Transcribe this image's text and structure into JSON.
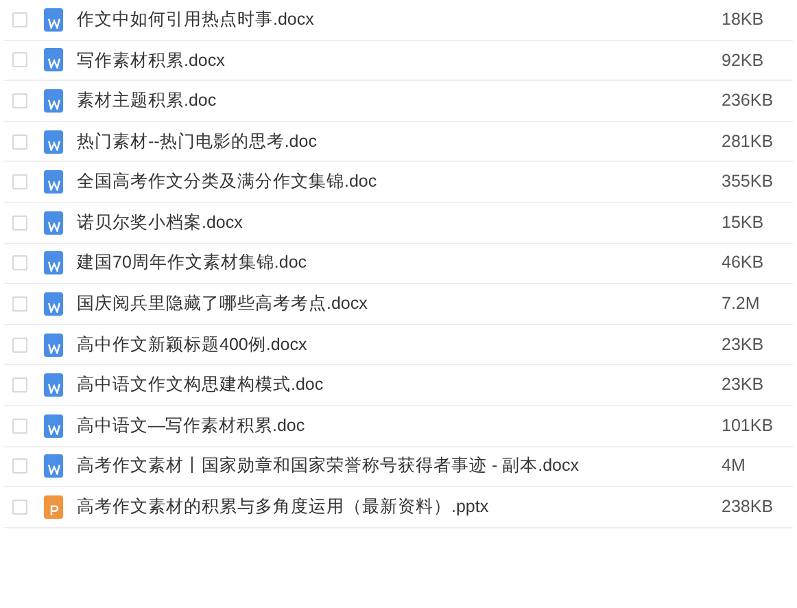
{
  "files": [
    {
      "kind": "word",
      "checked": false,
      "name": "作文中如何引用热点时事.docx",
      "size": "18KB"
    },
    {
      "kind": "word",
      "checked": false,
      "name": "写作素材积累.docx",
      "size": "92KB"
    },
    {
      "kind": "word",
      "checked": false,
      "name": "素材主题积累.doc",
      "size": "236KB"
    },
    {
      "kind": "word",
      "checked": false,
      "name": "热门素材--热门电影的思考.doc",
      "size": "281KB"
    },
    {
      "kind": "word",
      "checked": false,
      "name": "全国高考作文分类及满分作文集锦.doc",
      "size": "355KB"
    },
    {
      "kind": "word",
      "checked": false,
      "name": "诺贝尔奖小档案.docx",
      "size": "15KB"
    },
    {
      "kind": "word",
      "checked": false,
      "name": "建国70周年作文素材集锦.doc",
      "size": "46KB"
    },
    {
      "kind": "word",
      "checked": false,
      "name": "国庆阅兵里隐藏了哪些高考考点.docx",
      "size": "7.2M"
    },
    {
      "kind": "word",
      "checked": false,
      "name": "高中作文新颖标题400例.docx",
      "size": "23KB"
    },
    {
      "kind": "word",
      "checked": false,
      "name": "高中语文作文构思建构模式.doc",
      "size": "23KB"
    },
    {
      "kind": "word",
      "checked": false,
      "name": "高中语文—写作素材积累.doc",
      "size": "101KB"
    },
    {
      "kind": "word",
      "checked": false,
      "name": "高考作文素材丨国家勋章和国家荣誉称号获得者事迹 - 副本.docx",
      "size": "4M"
    },
    {
      "kind": "ppt",
      "checked": false,
      "name": "高考作文素材的积累与多角度运用（最新资料）.pptx",
      "size": "238KB"
    }
  ]
}
